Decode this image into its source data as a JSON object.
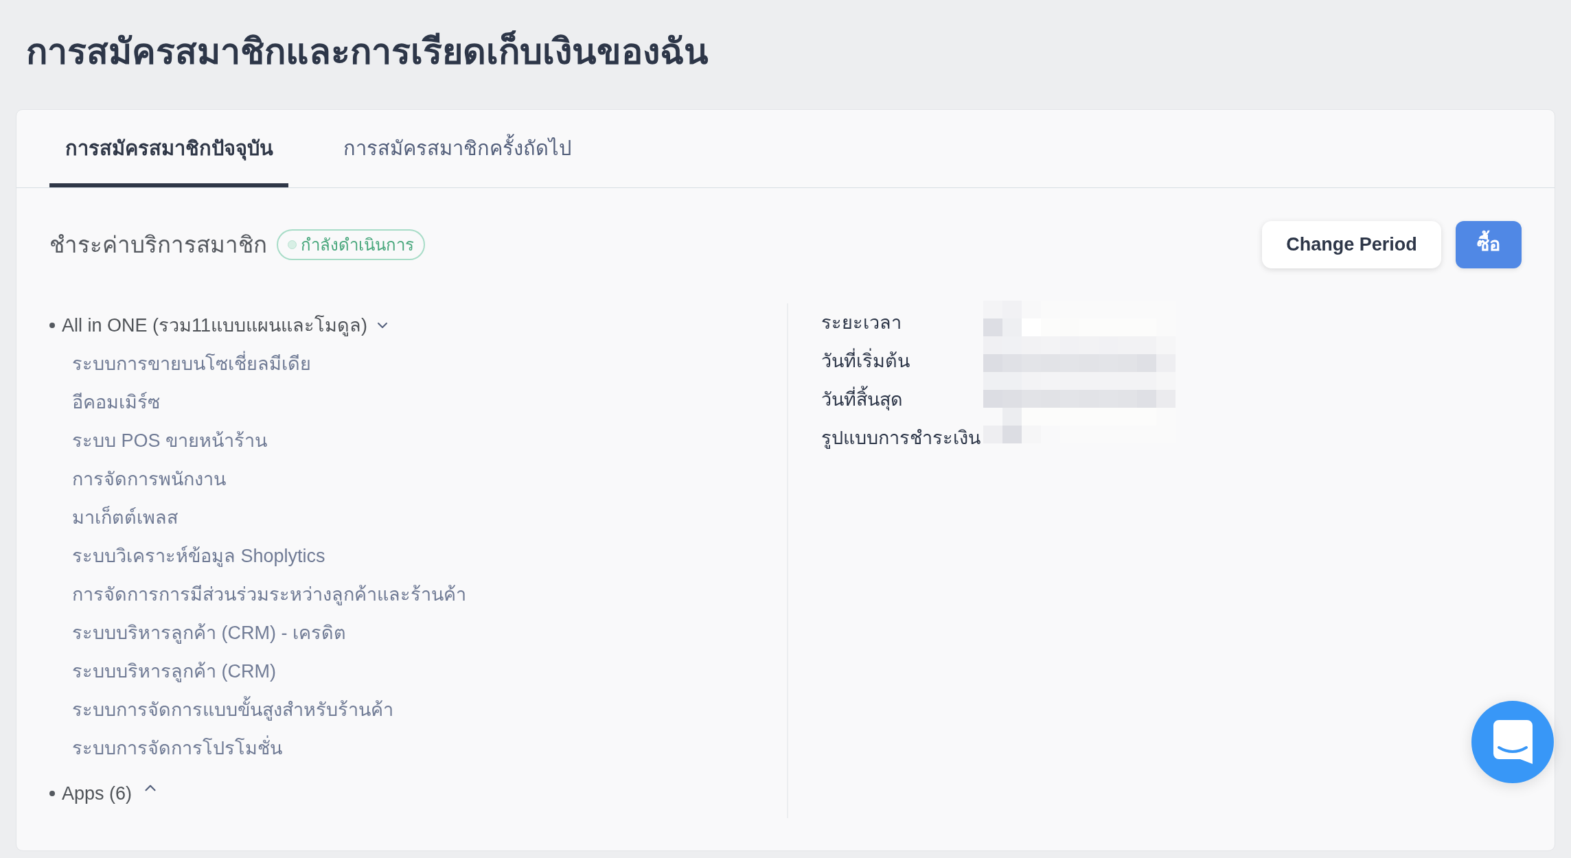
{
  "page": {
    "title": "การสมัครสมาชิกและการเรียดเก็บเงินของฉัน"
  },
  "tabs": [
    {
      "label": "การสมัครสมาชิกปัจจุบัน",
      "selected": true
    },
    {
      "label": "การสมัครสมาชิกครั้งถัดไป",
      "selected": false
    }
  ],
  "subscription": {
    "title": "ชำระค่าบริการสมาชิก",
    "status": "กำลังดำเนินการ",
    "buttons": [
      {
        "label": "Change Period",
        "kind": "secondary"
      },
      {
        "label": "ซื้อ",
        "kind": "primary"
      }
    ]
  },
  "packages": [
    {
      "name": "All in ONE (รวม11แบบแผนและโมดูล)",
      "expanded": true,
      "children": [
        {
          "name": "ระบบการขายบนโซเชี่ยลมีเดีย"
        },
        {
          "name": "อีคอมเมิร์ซ"
        },
        {
          "name": "ระบบ POS ขายหน้าร้าน"
        },
        {
          "name": "การจัดการพนักงาน"
        },
        {
          "name": "มาเก็ตต์เพลส"
        },
        {
          "name": "ระบบวิเคราะห์ข้อมูล Shoplytics"
        },
        {
          "name": "การจัดการการมีส่วนร่วมระหว่างลูกค้าและร้านค้า"
        },
        {
          "name": "ระบบบริหารลูกค้า (CRM) - เครดิต"
        },
        {
          "name": "ระบบบริหารลูกค้า (CRM)"
        },
        {
          "name": "ระบบการจัดการแบบขั้นสูงสำหรับร้านค้า"
        },
        {
          "name": "ระบบการจัดการโปรโมชั่น"
        }
      ]
    },
    {
      "name": "Apps (6)",
      "expanded": false
    }
  ],
  "details": [
    {
      "label": "ระยะเวลา"
    },
    {
      "label": "วันที่เริ่มต้น"
    },
    {
      "label": "วันที่สิ้นสุด"
    },
    {
      "label": "รูปแบบการชำระเงิน"
    }
  ]
}
